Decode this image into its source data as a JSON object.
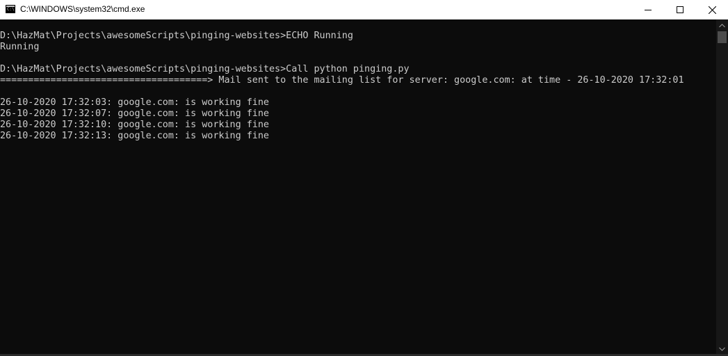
{
  "window": {
    "title": "C:\\WINDOWS\\system32\\cmd.exe",
    "icon_text": "C:\\"
  },
  "controls": {
    "minimize": "minimize-icon",
    "maximize": "maximize-icon",
    "close": "close-icon"
  },
  "terminal": {
    "lines": [
      "D:\\HazMat\\Projects\\awesomeScripts\\pinging-websites>ECHO Running",
      "Running",
      "D:\\HazMat\\Projects\\awesomeScripts\\pinging-websites>Call python pinging.py",
      "=====================================> Mail sent to the mailing list for server: google.com: at time - 26-10-2020 17:32:01",
      "26-10-2020 17:32:03: google.com: is working fine",
      "26-10-2020 17:32:07: google.com: is working fine",
      "26-10-2020 17:32:10: google.com: is working fine",
      "26-10-2020 17:32:13: google.com: is working fine"
    ]
  },
  "colors": {
    "background": "#0c0c0c",
    "foreground": "#cccccc",
    "titlebar": "#ffffff"
  }
}
